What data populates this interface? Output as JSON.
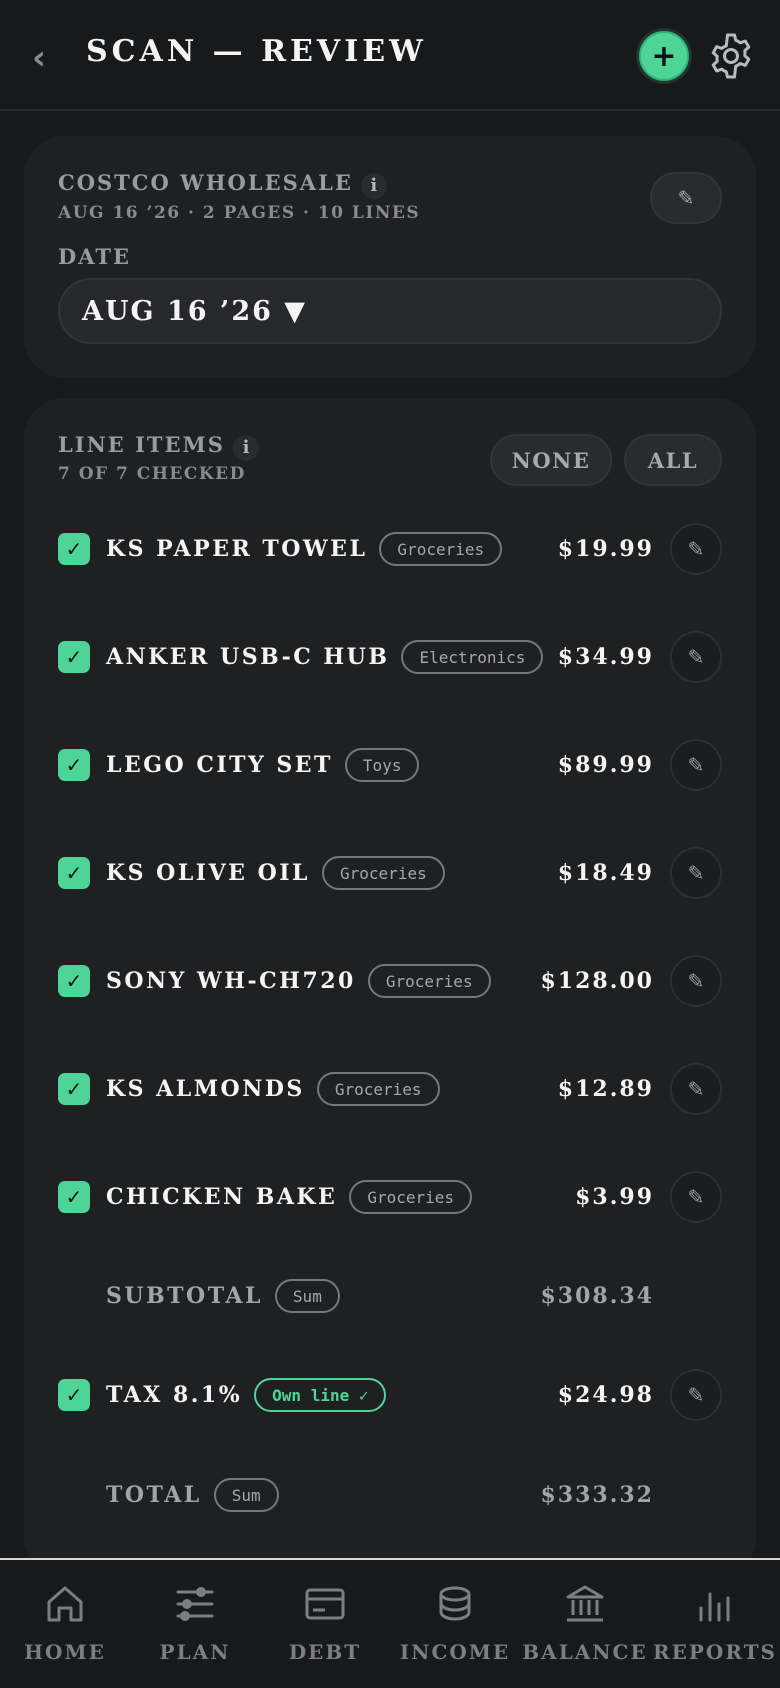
{
  "header": {
    "title": "SCAN — REVIEW",
    "back_icon": "chevron-left-icon",
    "add_icon": "plus-icon",
    "settings_icon": "gear-icon",
    "accent_color": "#4fd497"
  },
  "store": {
    "name": "COSTCO WHOLESALE",
    "meta": "AUG 16 ’26 · 2 PAGES · 10 LINES",
    "date_label": "DATE",
    "date_value": "AUG 16 ’26 ▼",
    "edit_glyph": "✎"
  },
  "line_items": {
    "title": "LINE ITEMS",
    "count": "7 OF 7 CHECKED",
    "none_label": "NONE",
    "all_label": "ALL",
    "items": [
      {
        "name": "KS PAPER TOWEL",
        "category": "Groceries",
        "price": "$19.99",
        "checked": true
      },
      {
        "name": "ANKER USB-C HUB",
        "category": "Electronics",
        "price": "$34.99",
        "checked": true
      },
      {
        "name": "LEGO CITY SET",
        "category": "Toys",
        "price": "$89.99",
        "checked": true
      },
      {
        "name": "KS OLIVE OIL",
        "category": "Groceries",
        "price": "$18.49",
        "checked": true
      },
      {
        "name": "SONY WH-CH720",
        "category": "Groceries",
        "price": "$128.00",
        "checked": true
      },
      {
        "name": "KS ALMONDS",
        "category": "Groceries",
        "price": "$12.89",
        "checked": true
      },
      {
        "name": "CHICKEN BAKE",
        "category": "Groceries",
        "price": "$3.99",
        "checked": true
      }
    ],
    "subtotal": {
      "name": "SUBTOTAL",
      "tag": "Sum",
      "price": "$308.34"
    },
    "tax": {
      "name": "TAX 8.1%",
      "tag": "Own line ✓",
      "price": "$24.98",
      "checked": true
    },
    "total": {
      "name": "TOTAL",
      "tag": "Sum",
      "price": "$333.32"
    },
    "check_glyph": "✓",
    "edit_glyph": "✎"
  },
  "nav": {
    "items": [
      {
        "label": "HOME",
        "icon": "home-icon"
      },
      {
        "label": "PLAN",
        "icon": "sliders-icon"
      },
      {
        "label": "DEBT",
        "icon": "credit-card-icon"
      },
      {
        "label": "INCOME",
        "icon": "coins-icon"
      },
      {
        "label": "BALANCE",
        "icon": "bank-icon"
      },
      {
        "label": "REPORTS",
        "icon": "bar-chart-icon"
      }
    ]
  }
}
